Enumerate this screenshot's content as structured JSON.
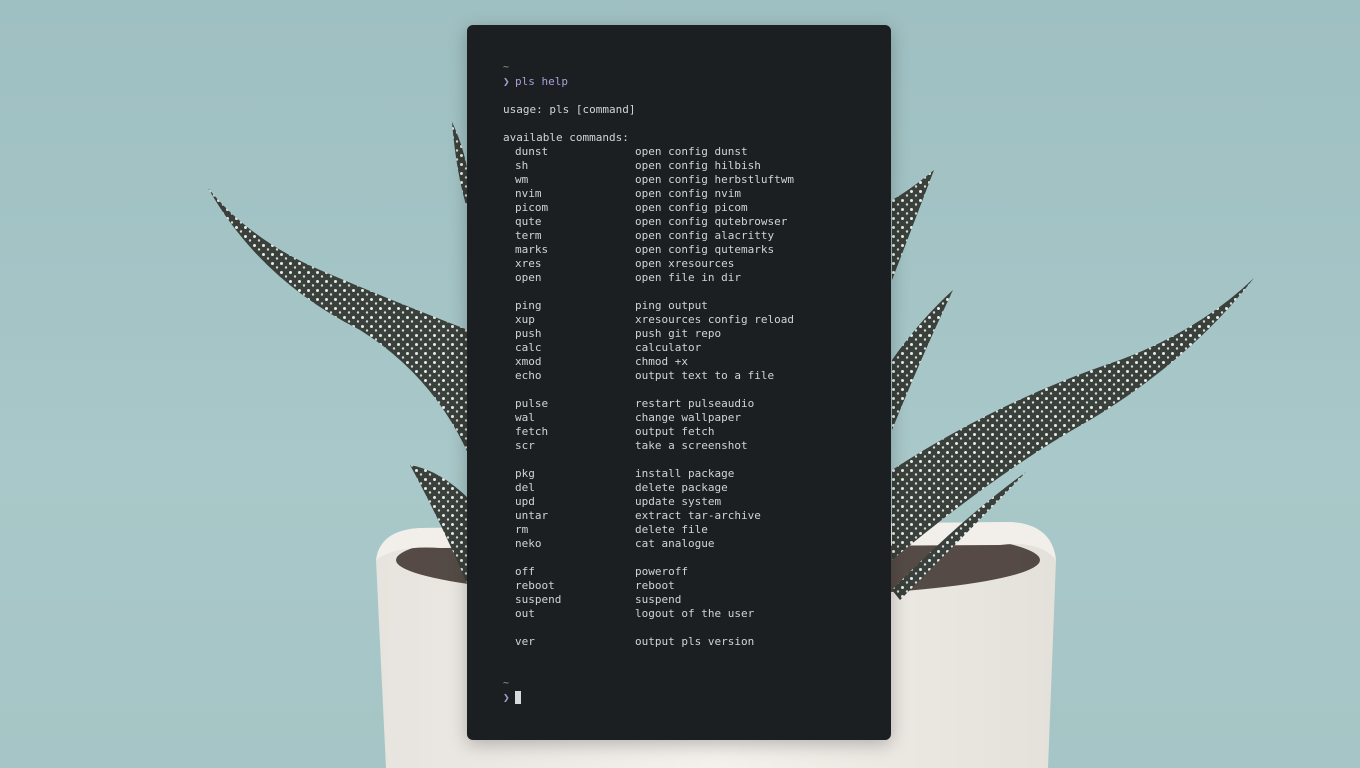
{
  "terminal": {
    "prompt_dir": "~",
    "prompt_symbol": "❯",
    "command": "pls help",
    "usage": "usage: pls [command]",
    "header": "available commands:",
    "groups": [
      [
        {
          "cmd": "dunst",
          "desc": "open config dunst"
        },
        {
          "cmd": "sh",
          "desc": "open config hilbish"
        },
        {
          "cmd": "wm",
          "desc": "open config herbstluftwm"
        },
        {
          "cmd": "nvim",
          "desc": "open config nvim"
        },
        {
          "cmd": "picom",
          "desc": "open config picom"
        },
        {
          "cmd": "qute",
          "desc": "open config qutebrowser"
        },
        {
          "cmd": "term",
          "desc": "open config alacritty"
        },
        {
          "cmd": "marks",
          "desc": "open config qutemarks"
        },
        {
          "cmd": "xres",
          "desc": "open xresources"
        },
        {
          "cmd": "open",
          "desc": "open file in dir"
        }
      ],
      [
        {
          "cmd": "ping",
          "desc": "ping output"
        },
        {
          "cmd": "xup",
          "desc": "xresources config reload"
        },
        {
          "cmd": "push",
          "desc": "push git repo"
        },
        {
          "cmd": "calc",
          "desc": "calculator"
        },
        {
          "cmd": "xmod",
          "desc": "chmod +x"
        },
        {
          "cmd": "echo",
          "desc": "output text to a file"
        }
      ],
      [
        {
          "cmd": "pulse",
          "desc": "restart pulseaudio"
        },
        {
          "cmd": "wal",
          "desc": "change wallpaper"
        },
        {
          "cmd": "fetch",
          "desc": "output fetch"
        },
        {
          "cmd": "scr",
          "desc": "take a screenshot"
        }
      ],
      [
        {
          "cmd": "pkg",
          "desc": "install package"
        },
        {
          "cmd": "del",
          "desc": "delete package"
        },
        {
          "cmd": "upd",
          "desc": "update system"
        },
        {
          "cmd": "untar",
          "desc": "extract tar-archive"
        },
        {
          "cmd": "rm",
          "desc": "delete file"
        },
        {
          "cmd": "neko",
          "desc": "cat analogue"
        }
      ],
      [
        {
          "cmd": "off",
          "desc": "poweroff"
        },
        {
          "cmd": "reboot",
          "desc": "reboot"
        },
        {
          "cmd": "suspend",
          "desc": "suspend"
        },
        {
          "cmd": "out",
          "desc": "logout of the user"
        }
      ],
      [
        {
          "cmd": "ver",
          "desc": "output pls version"
        }
      ]
    ]
  },
  "colors": {
    "terminal_bg": "#1c1f22",
    "text": "#d1d4d6",
    "prompt_accent": "#a9a0d8"
  }
}
